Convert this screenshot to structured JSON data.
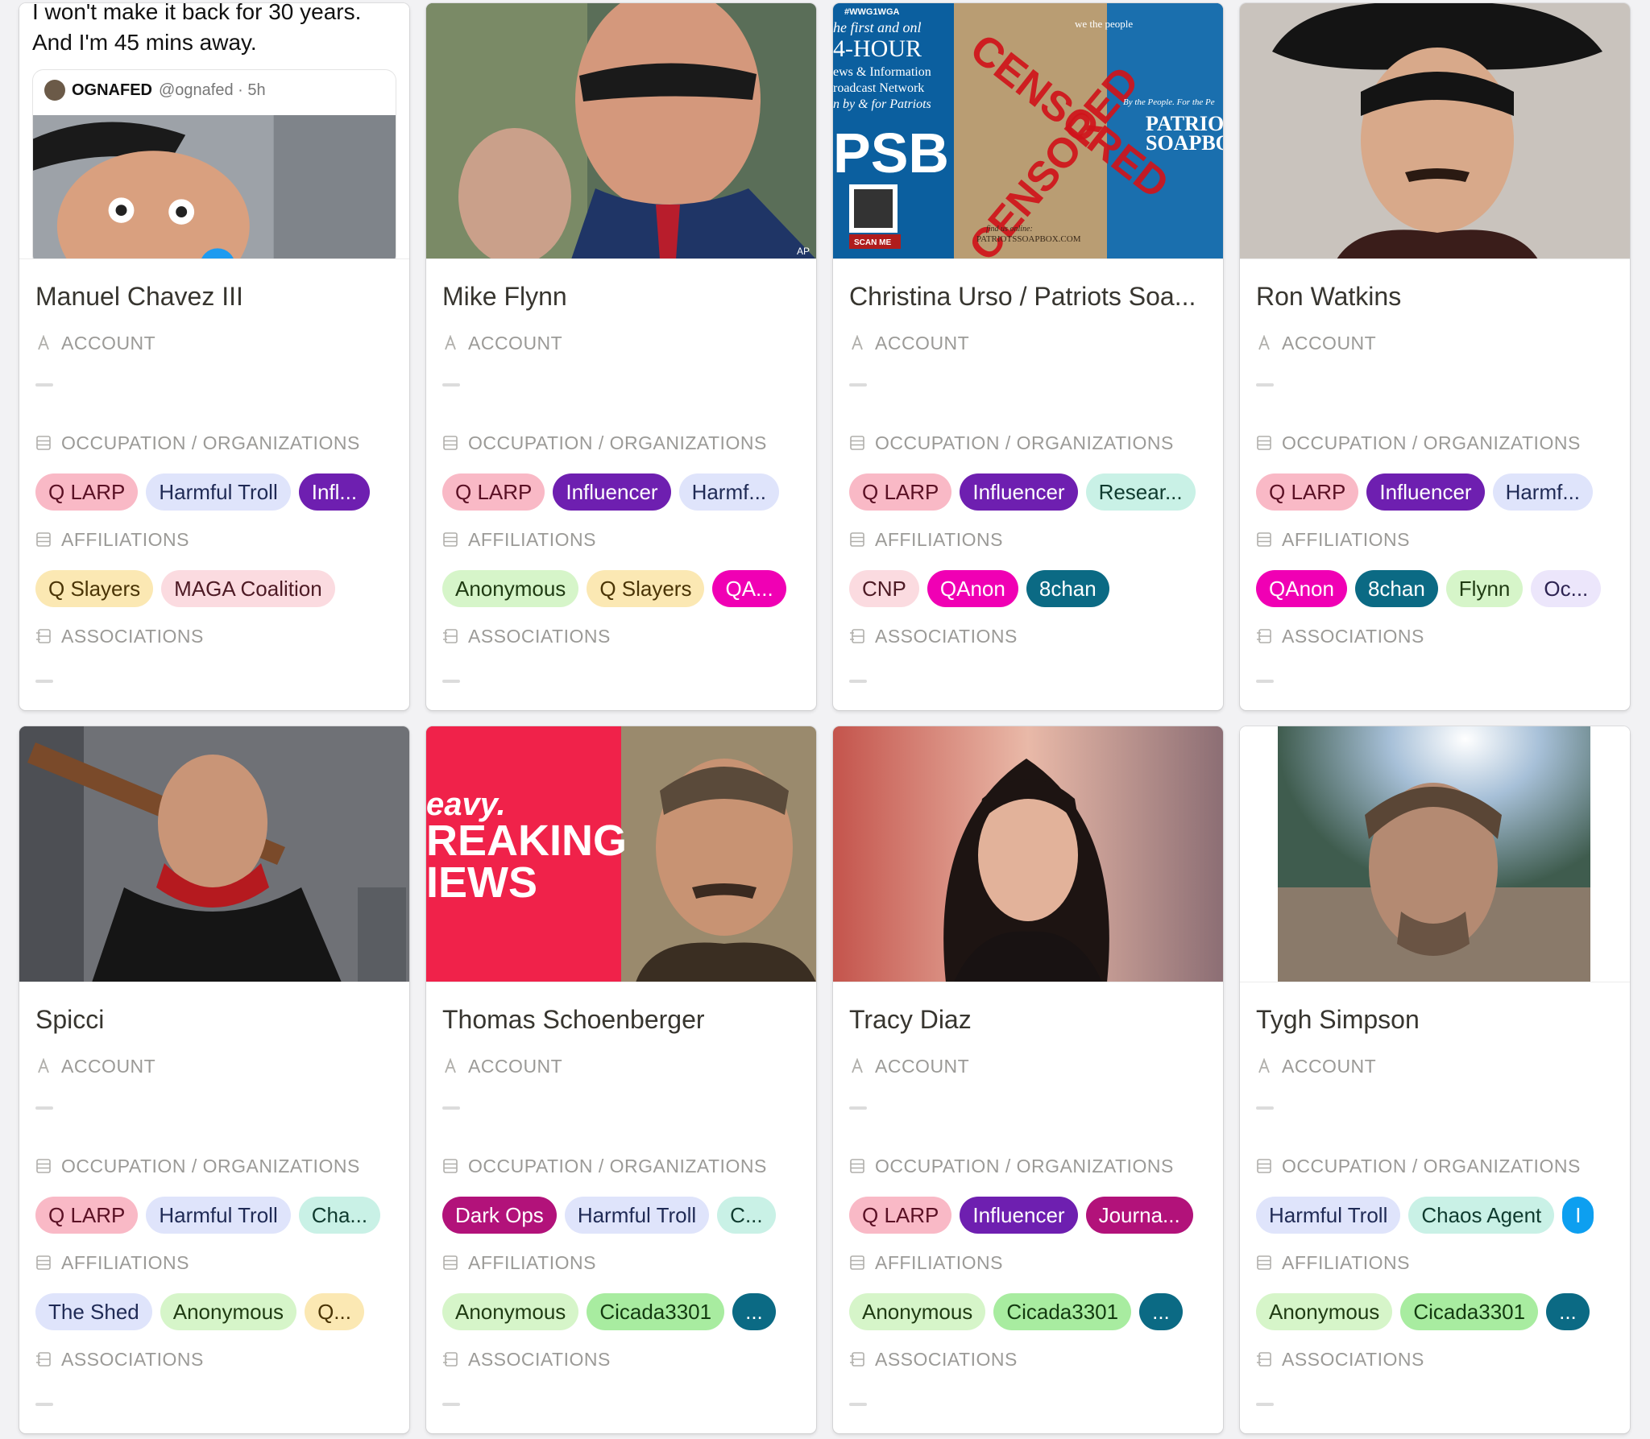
{
  "labels": {
    "account": "ACCOUNT",
    "occupation": "OCCUPATION / ORGANIZATIONS",
    "affiliations": "AFFILIATIONS",
    "associations": "ASSOCIATIONS"
  },
  "cards": [
    {
      "name": "Manuel Chavez III",
      "cover": {
        "type": "tweet",
        "text_line1": "I won't make it back for 30 years.",
        "text_line2": "And I'm 45 mins away.",
        "quote_name": "OGNAFED",
        "quote_handle": "@ognafed · 5h"
      },
      "occupations": [
        {
          "label": "Q LARP",
          "color": "pink"
        },
        {
          "label": "Harmful Troll",
          "color": "lav"
        },
        {
          "label": "Infl...",
          "color": "purple"
        }
      ],
      "affiliations": [
        {
          "label": "Q Slayers",
          "color": "yellow"
        },
        {
          "label": "MAGA Coalition",
          "color": "rose"
        }
      ]
    },
    {
      "name": "Mike Flynn",
      "cover": {
        "type": "photo",
        "caption": "AP"
      },
      "occupations": [
        {
          "label": "Q LARP",
          "color": "pink"
        },
        {
          "label": "Influencer",
          "color": "purple"
        },
        {
          "label": "Harmf...",
          "color": "lav"
        }
      ],
      "affiliations": [
        {
          "label": "Anonymous",
          "color": "green"
        },
        {
          "label": "Q Slayers",
          "color": "yellow"
        },
        {
          "label": "QA...",
          "color": "magenta"
        }
      ]
    },
    {
      "name": "Christina Urso / Patriots Soa...",
      "cover": {
        "type": "banner",
        "top_tag": "#WWG1WGA",
        "left_lines": [
          "he first and onl",
          "4-HOUR",
          "ews & Information",
          "roadcast Network",
          "n by & for Patriots"
        ],
        "big": "PSB",
        "stamp_top": "CENSORED",
        "stamp_bottom": "CENSORED",
        "right_small": "we the people",
        "right_line": "By the People. For the Pe",
        "right_big1": "PATRIOT",
        "right_big2": "SOAPBO",
        "scan": "SCAN ME",
        "footer": "PATRIOTSSOAPBOX.COM",
        "footer_small": "find us online:"
      },
      "occupations": [
        {
          "label": "Q LARP",
          "color": "pink"
        },
        {
          "label": "Influencer",
          "color": "purple"
        },
        {
          "label": "Resear...",
          "color": "mint"
        }
      ],
      "affiliations": [
        {
          "label": "CNP",
          "color": "rose"
        },
        {
          "label": "QAnon",
          "color": "magenta"
        },
        {
          "label": "8chan",
          "color": "teal"
        }
      ]
    },
    {
      "name": "Ron Watkins",
      "cover": {
        "type": "photo"
      },
      "occupations": [
        {
          "label": "Q LARP",
          "color": "pink"
        },
        {
          "label": "Influencer",
          "color": "purple"
        },
        {
          "label": "Harmf...",
          "color": "lav"
        }
      ],
      "affiliations": [
        {
          "label": "QAnon",
          "color": "magenta"
        },
        {
          "label": "8chan",
          "color": "teal"
        },
        {
          "label": "Flynn",
          "color": "green"
        },
        {
          "label": "Oc...",
          "color": "lilac"
        }
      ]
    },
    {
      "name": "Spicci",
      "cover": {
        "type": "photo"
      },
      "occupations": [
        {
          "label": "Q LARP",
          "color": "pink"
        },
        {
          "label": "Harmful Troll",
          "color": "lav"
        },
        {
          "label": "Cha...",
          "color": "mint"
        }
      ],
      "affiliations": [
        {
          "label": "The Shed",
          "color": "lav"
        },
        {
          "label": "Anonymous",
          "color": "green"
        },
        {
          "label": "Q...",
          "color": "yellow"
        }
      ]
    },
    {
      "name": "Thomas Schoenberger",
      "cover": {
        "type": "news",
        "line1": "eavy.",
        "line2": "REAKING",
        "line3": "IEWS"
      },
      "occupations": [
        {
          "label": "Dark Ops",
          "color": "plum"
        },
        {
          "label": "Harmful Troll",
          "color": "lav"
        },
        {
          "label": "C...",
          "color": "mint"
        }
      ],
      "affiliations": [
        {
          "label": "Anonymous",
          "color": "green"
        },
        {
          "label": "Cicada3301",
          "color": "brightgreen"
        },
        {
          "label": "...",
          "color": "teal"
        }
      ]
    },
    {
      "name": "Tracy Diaz",
      "cover": {
        "type": "photo"
      },
      "occupations": [
        {
          "label": "Q LARP",
          "color": "pink"
        },
        {
          "label": "Influencer",
          "color": "purple"
        },
        {
          "label": "Journa...",
          "color": "plum"
        }
      ],
      "affiliations": [
        {
          "label": "Anonymous",
          "color": "green"
        },
        {
          "label": "Cicada3301",
          "color": "brightgreen"
        },
        {
          "label": "...",
          "color": "teal"
        }
      ]
    },
    {
      "name": "Tygh Simpson",
      "cover": {
        "type": "photo"
      },
      "occupations": [
        {
          "label": "Harmful Troll",
          "color": "lav"
        },
        {
          "label": "Chaos Agent",
          "color": "mint"
        },
        {
          "label": "I",
          "color": "blue"
        }
      ],
      "affiliations": [
        {
          "label": "Anonymous",
          "color": "green"
        },
        {
          "label": "Cicada3301",
          "color": "brightgreen"
        },
        {
          "label": "...",
          "color": "teal"
        }
      ]
    }
  ]
}
